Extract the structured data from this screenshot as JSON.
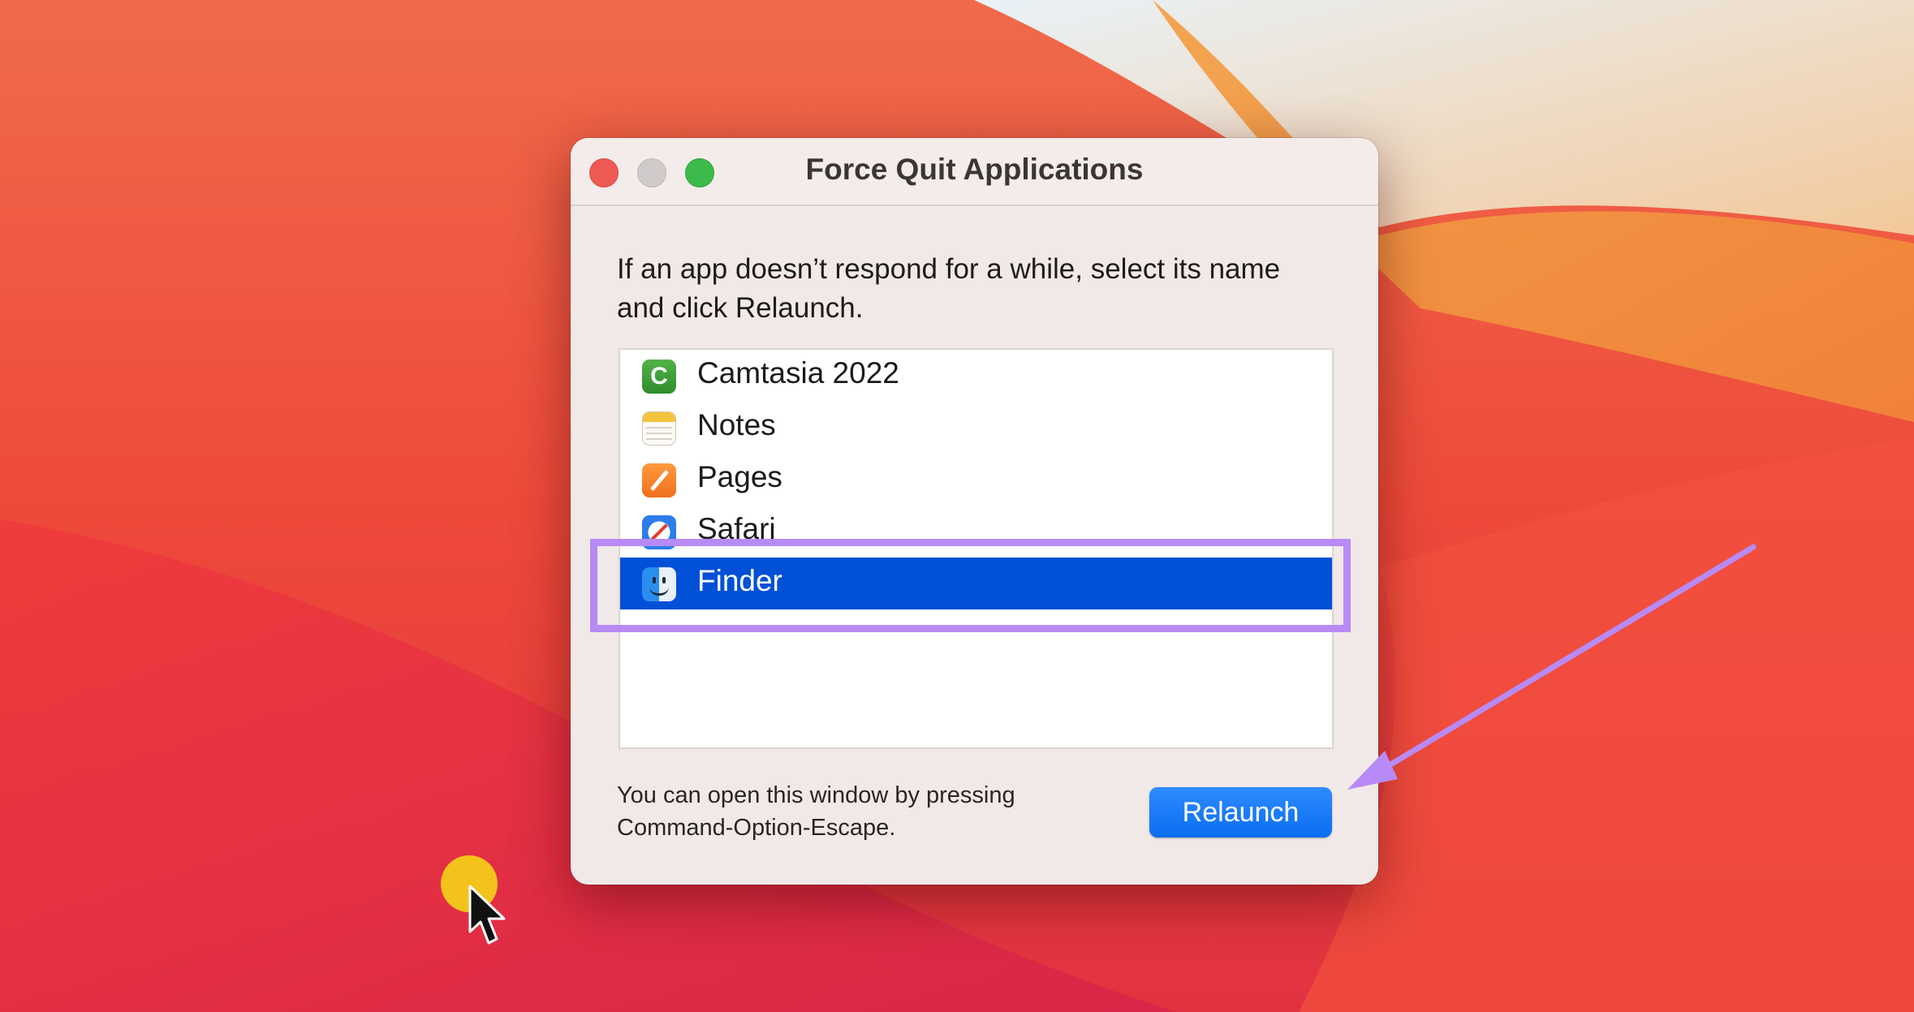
{
  "window": {
    "title": "Force Quit Applications",
    "prompt": "If an app doesn’t respond for a while, select its name and click Relaunch.",
    "footnote_line1": "You can open this window by pressing",
    "footnote_line2": "Command-Option-Escape.",
    "relaunch_label": "Relaunch"
  },
  "apps": [
    {
      "name": "Camtasia 2022",
      "icon": "camtasia-icon",
      "icon_letter": "C"
    },
    {
      "name": "Notes",
      "icon": "notes-icon"
    },
    {
      "name": "Pages",
      "icon": "pages-icon"
    },
    {
      "name": "Safari",
      "icon": "safari-icon"
    },
    {
      "name": "Finder",
      "icon": "finder-icon",
      "selected": true
    }
  ],
  "colors": {
    "selection": "#0250d7",
    "highlight_annotation": "#b78af5",
    "button": "#0a6ef0",
    "cursor_highlight": "#f4c31b"
  }
}
